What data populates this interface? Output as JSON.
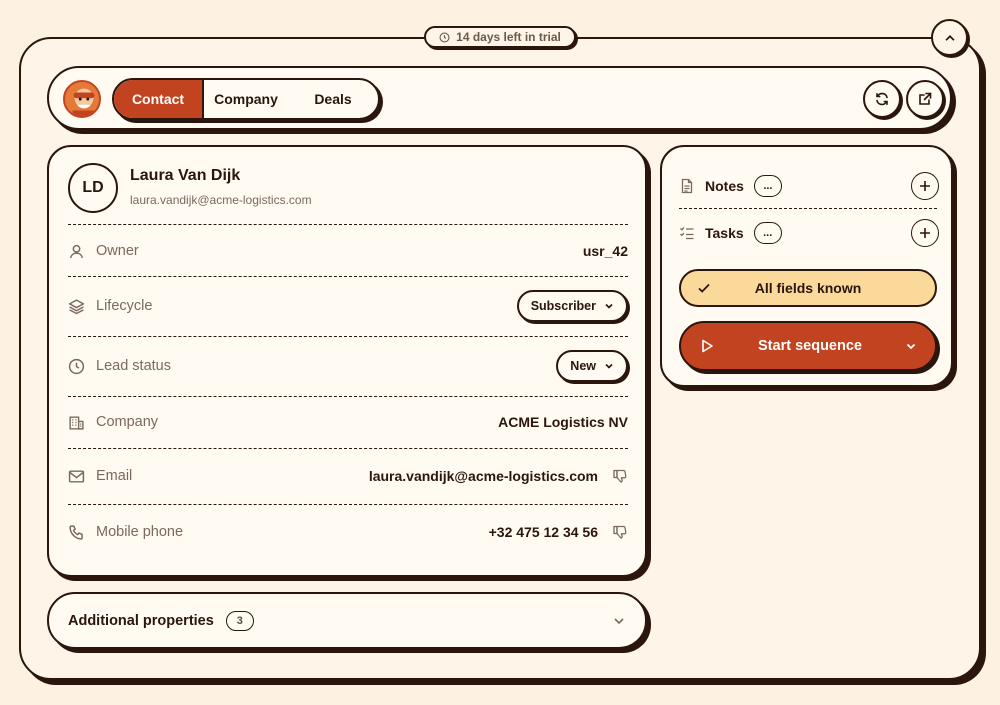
{
  "trial": {
    "text": "14 days left in trial"
  },
  "tabs": [
    {
      "label": "Contact",
      "active": true
    },
    {
      "label": "Company",
      "active": false
    },
    {
      "label": "Deals",
      "active": false
    }
  ],
  "contact": {
    "initials": "LD",
    "name": "Laura Van Dijk",
    "email": "laura.vandijk@acme-logistics.com"
  },
  "properties": {
    "owner": {
      "label": "Owner",
      "value": "usr_42",
      "icon": "person-icon"
    },
    "lifecycle": {
      "label": "Lifecycle",
      "value": "Subscriber",
      "icon": "layers-icon"
    },
    "lead_status": {
      "label": "Lead status",
      "value": "New",
      "icon": "clock-icon"
    },
    "company": {
      "label": "Company",
      "value": "ACME Logistics NV",
      "icon": "building-icon"
    },
    "email": {
      "label": "Email",
      "value": "laura.vandijk@acme-logistics.com",
      "icon": "mail-icon"
    },
    "phone": {
      "label": "Mobile phone",
      "value": "+32 475 12 34 56",
      "icon": "phone-icon"
    }
  },
  "additional": {
    "label": "Additional properties",
    "count": "3"
  },
  "sidebar": {
    "notes": {
      "label": "Notes",
      "badge": "..."
    },
    "tasks": {
      "label": "Tasks",
      "badge": "..."
    },
    "known": {
      "label": "All fields known"
    },
    "start": {
      "label": "Start sequence"
    }
  },
  "colors": {
    "accent": "#c2431f",
    "background": "#fdf1e2",
    "ink": "#2a160c",
    "known_bg": "#fbd99a"
  }
}
